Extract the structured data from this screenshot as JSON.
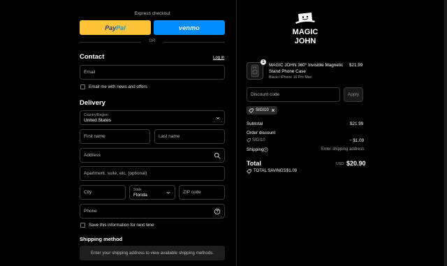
{
  "express": {
    "title": "Express checkout",
    "paypal_a": "Pay",
    "paypal_b": "Pal",
    "venmo": "venmo",
    "or": "OR"
  },
  "contact": {
    "title": "Contact",
    "login": "Log in",
    "email_placeholder": "Email",
    "news_label": "Email me with news and offers"
  },
  "delivery": {
    "title": "Delivery",
    "country_label": "Country/Region",
    "country_value": "United States",
    "first_name": "First name",
    "last_name": "Last name",
    "address": "Address",
    "apartment": "Apartment, suite, etc. (optional)",
    "city": "City",
    "state_label": "State",
    "state_value": "Florida",
    "zip": "ZIP code",
    "phone": "Phone",
    "save_label": "Save this information for next time"
  },
  "shipping": {
    "title": "Shipping method",
    "message": "Enter your shipping address to view available shipping methods."
  },
  "brand": {
    "line1": "MAGIC",
    "line2": "JOHN"
  },
  "cart": {
    "quantity": "1",
    "product_title_1": "MAGIC JOHN 360° Invisible Magnetic",
    "product_title_2": "Stand Phone Case",
    "variant": "Black / iPhone 16 Pro Max",
    "price": "$21.99"
  },
  "discount": {
    "placeholder": "Discount code",
    "apply": "Apply",
    "chip_code": "SIGI10"
  },
  "summary": {
    "subtotal_label": "Subtotal",
    "subtotal_value": "$21.99",
    "order_discount_label": "Order discount",
    "code": "SIGI10",
    "discount_value": "− $1.09",
    "shipping_label": "Shipping",
    "shipping_value": "Enter shipping address",
    "total_label": "Total",
    "currency": "USD",
    "total_value": "$20.90",
    "savings_label": "TOTAL SAVINGS",
    "savings_value": "$1.09"
  }
}
